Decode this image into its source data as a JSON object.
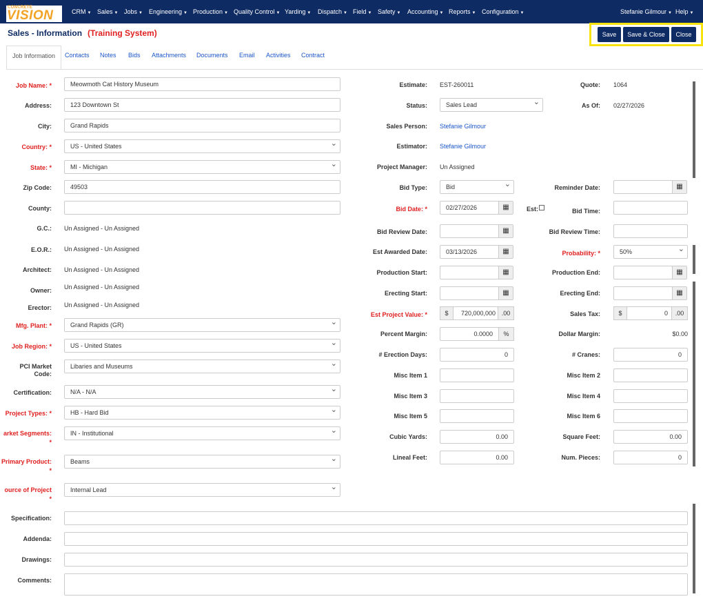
{
  "brand": {
    "small": "CONCRETE",
    "big_prefix": "",
    "big": "VISION"
  },
  "nav": {
    "menus": [
      "CRM",
      "Sales",
      "Jobs",
      "Engineering",
      "Production",
      "Quality Control",
      "Yarding",
      "Dispatch",
      "Field",
      "Safety",
      "Accounting",
      "Reports",
      "Configuration"
    ],
    "user": "Stefanie Gilmour",
    "help": "Help"
  },
  "page": {
    "title": "Sales - Information",
    "training": "(Training System)"
  },
  "buttons": {
    "save": "Save",
    "save_close": "Save & Close",
    "close": "Close"
  },
  "tabs": [
    "Job Information",
    "Contacts",
    "Notes",
    "Bids",
    "Attachments",
    "Documents",
    "Email",
    "Activities",
    "Contract"
  ],
  "left": {
    "job_name": {
      "label": "Job Name:",
      "value": "Meowmoth Cat History Museum"
    },
    "address": {
      "label": "Address:",
      "value": "123 Downtown St"
    },
    "city": {
      "label": "City:",
      "value": "Grand Rapids"
    },
    "country": {
      "label": "Country:",
      "value": "US - United States"
    },
    "state": {
      "label": "State:",
      "value": "MI - Michigan"
    },
    "zip": {
      "label": "Zip Code:",
      "value": "49503"
    },
    "county": {
      "label": "County:",
      "value": ""
    },
    "gc": {
      "label": "G.C.:",
      "value": "Un Assigned - Un Assigned"
    },
    "eor": {
      "label": "E.O.R.:",
      "value": "Un Assigned - Un Assigned"
    },
    "architect": {
      "label": "Architect:",
      "value": "Un Assigned - Un Assigned"
    },
    "owner": {
      "label": "Owner:",
      "value": "Un Assigned - Un Assigned"
    },
    "erector": {
      "label": "Erector:",
      "value": "Un Assigned - Un Assigned"
    },
    "mfg_plant": {
      "label": "Mfg. Plant:",
      "value": "Grand Rapids (GR)"
    },
    "job_region": {
      "label": "Job Region:",
      "value": "US - United States"
    },
    "pci_market": {
      "label": "PCI Market Code:",
      "value": "Libaries and Museums"
    },
    "certification": {
      "label": "Certification:",
      "value": "N/A - N/A"
    },
    "project_types": {
      "label": "Project Types:",
      "value": "HB - Hard Bid"
    },
    "market_segments": {
      "label": "arket Segments:",
      "value": "IN - Institutional"
    },
    "primary_product": {
      "label": "Primary Product:",
      "value": "Beams"
    },
    "source": {
      "label": "ource of Project",
      "value": "Internal Lead"
    },
    "specification": {
      "label": "Specification:",
      "value": ""
    },
    "addenda": {
      "label": "Addenda:",
      "value": ""
    },
    "drawings": {
      "label": "Drawings:",
      "value": ""
    },
    "comments": {
      "label": "Comments:",
      "value": ""
    }
  },
  "mid": {
    "estimate": {
      "label": "Estimate:",
      "value": "EST-260011"
    },
    "status": {
      "label": "Status:",
      "value": "Sales Lead"
    },
    "sales_person": {
      "label": "Sales Person:",
      "value": "Stefanie Gilmour"
    },
    "estimator": {
      "label": "Estimator:",
      "value": "Stefanie Gilmour"
    },
    "project_manager": {
      "label": "Project Manager:",
      "value": "Un Assigned"
    },
    "bid_type": {
      "label": "Bid Type:",
      "value": "Bid"
    },
    "bid_date": {
      "label": "Bid Date:",
      "value": "02/27/2026"
    },
    "est": {
      "label": "Est:"
    },
    "bid_review_date": {
      "label": "Bid Review Date:",
      "value": ""
    },
    "est_awarded_date": {
      "label": "Est Awarded Date:",
      "value": "03/13/2026"
    },
    "production_start": {
      "label": "Production Start:",
      "value": ""
    },
    "erecting_start": {
      "label": "Erecting Start:",
      "value": ""
    },
    "est_project_value": {
      "label": "Est Project Value:",
      "currency": "$",
      "value": "720,000,000",
      "cents": ".00"
    },
    "percent_margin": {
      "label": "Percent Margin:",
      "value": "0.0000",
      "unit": "%"
    },
    "erection_days": {
      "label": "# Erection Days:",
      "value": "0"
    },
    "misc1": {
      "label": "Misc Item 1",
      "value": ""
    },
    "misc3": {
      "label": "Misc Item 3",
      "value": ""
    },
    "misc5": {
      "label": "Misc Item 5",
      "value": ""
    },
    "cubic_yards": {
      "label": "Cubic Yards:",
      "value": "0.00"
    },
    "lineal_feet": {
      "label": "Lineal Feet:",
      "value": "0.00"
    }
  },
  "right": {
    "quote": {
      "label": "Quote:",
      "value": "1064"
    },
    "as_of": {
      "label": "As Of:",
      "value": "02/27/2026"
    },
    "reminder_date": {
      "label": "Reminder Date:",
      "value": ""
    },
    "bid_time": {
      "label": "Bid Time:",
      "value": ""
    },
    "bid_review_time": {
      "label": "Bid Review Time:",
      "value": ""
    },
    "probability": {
      "label": "Probability:",
      "value": "50%"
    },
    "production_end": {
      "label": "Production End:",
      "value": ""
    },
    "erecting_end": {
      "label": "Erecting End:",
      "value": ""
    },
    "sales_tax": {
      "label": "Sales Tax:",
      "currency": "$",
      "value": "0",
      "cents": ".00"
    },
    "dollar_margin": {
      "label": "Dollar Margin:",
      "value": "$0.00"
    },
    "cranes": {
      "label": "# Cranes:",
      "value": "0"
    },
    "misc2": {
      "label": "Misc Item 2",
      "value": ""
    },
    "misc4": {
      "label": "Misc Item 4",
      "value": ""
    },
    "misc6": {
      "label": "Misc Item 6",
      "value": ""
    },
    "square_feet": {
      "label": "Square Feet:",
      "value": "0.00"
    },
    "num_pieces": {
      "label": "Num. Pieces:",
      "value": "0"
    }
  },
  "required_marker": "*",
  "calendar_icon": "▦"
}
